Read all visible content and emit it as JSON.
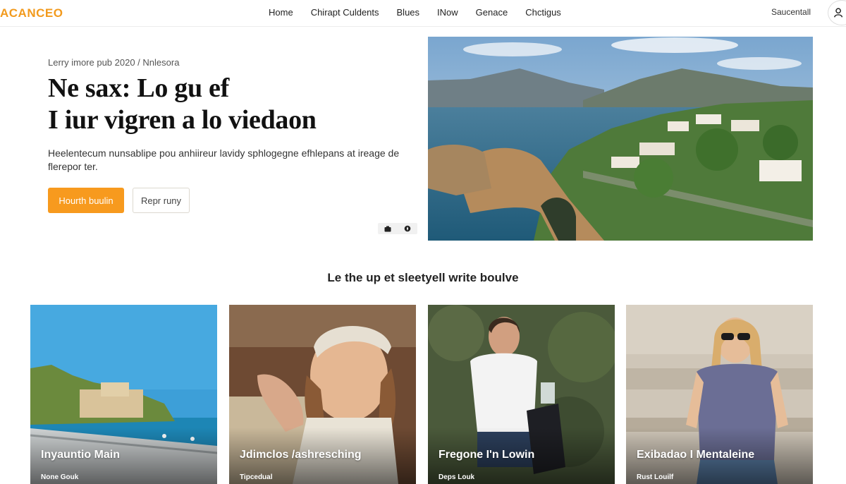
{
  "header": {
    "logo": "ACANCEO",
    "nav": [
      "Home",
      "Chirapt Culdents",
      "Blues",
      "INow",
      "Genace",
      "Chctigus"
    ],
    "signin": "Saucentall"
  },
  "hero": {
    "breadcrumb": "Lerry imore pub 2020 / Nnlesora",
    "title_line1": "Ne sax: Lo gu ef",
    "title_line2": "I  iur vigren a lo viedaon",
    "description": "Heelentecum nunsablipe pou anhiireur lavidy sphlogegne efhlepans at ireage de flerepor ter.",
    "primary_button": "Hourth buulin",
    "secondary_button": "Repr runy",
    "image_icon": "coastal-village-photo"
  },
  "section": {
    "title": "Le the up et sleetyell write boulve"
  },
  "cards": [
    {
      "title": "Inyauntio Main",
      "subtitle": "None Gouk",
      "image": "seaside-promenade-photo"
    },
    {
      "title": "Jdimclos /ashresching",
      "subtitle": "Tipcedual",
      "image": "girl-headband-photo"
    },
    {
      "title": "Fregone I'n Lowin",
      "subtitle": "Deps Louk",
      "image": "woman-white-shirt-photo"
    },
    {
      "title": "Exibadao I Mentaleine",
      "subtitle": "Rust Louilf",
      "image": "woman-sunglasses-photo"
    }
  ],
  "colors": {
    "accent": "#f79a1e",
    "logo": "#f29a1d"
  }
}
